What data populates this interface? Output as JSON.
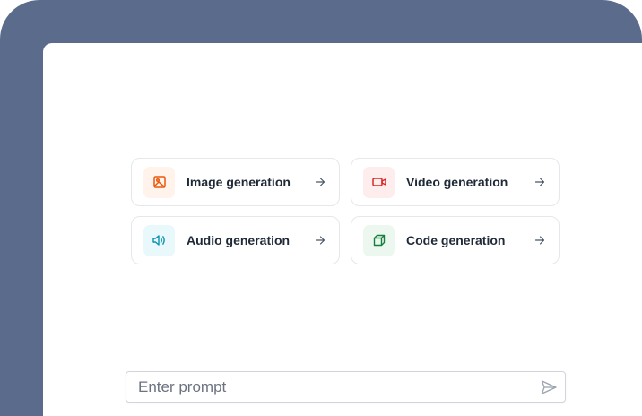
{
  "cards": [
    {
      "label": "Image generation",
      "icon": "image-icon",
      "color": "#ea580c",
      "bg": "#fff3ec"
    },
    {
      "label": "Video generation",
      "icon": "video-icon",
      "color": "#dc2626",
      "bg": "#fdeded"
    },
    {
      "label": "Audio generation",
      "icon": "audio-icon",
      "color": "#0891b2",
      "bg": "#e8f8fb"
    },
    {
      "label": "Code generation",
      "icon": "code-icon",
      "color": "#15803d",
      "bg": "#ecf8ef"
    }
  ],
  "prompt": {
    "placeholder": "Enter prompt",
    "value": ""
  }
}
